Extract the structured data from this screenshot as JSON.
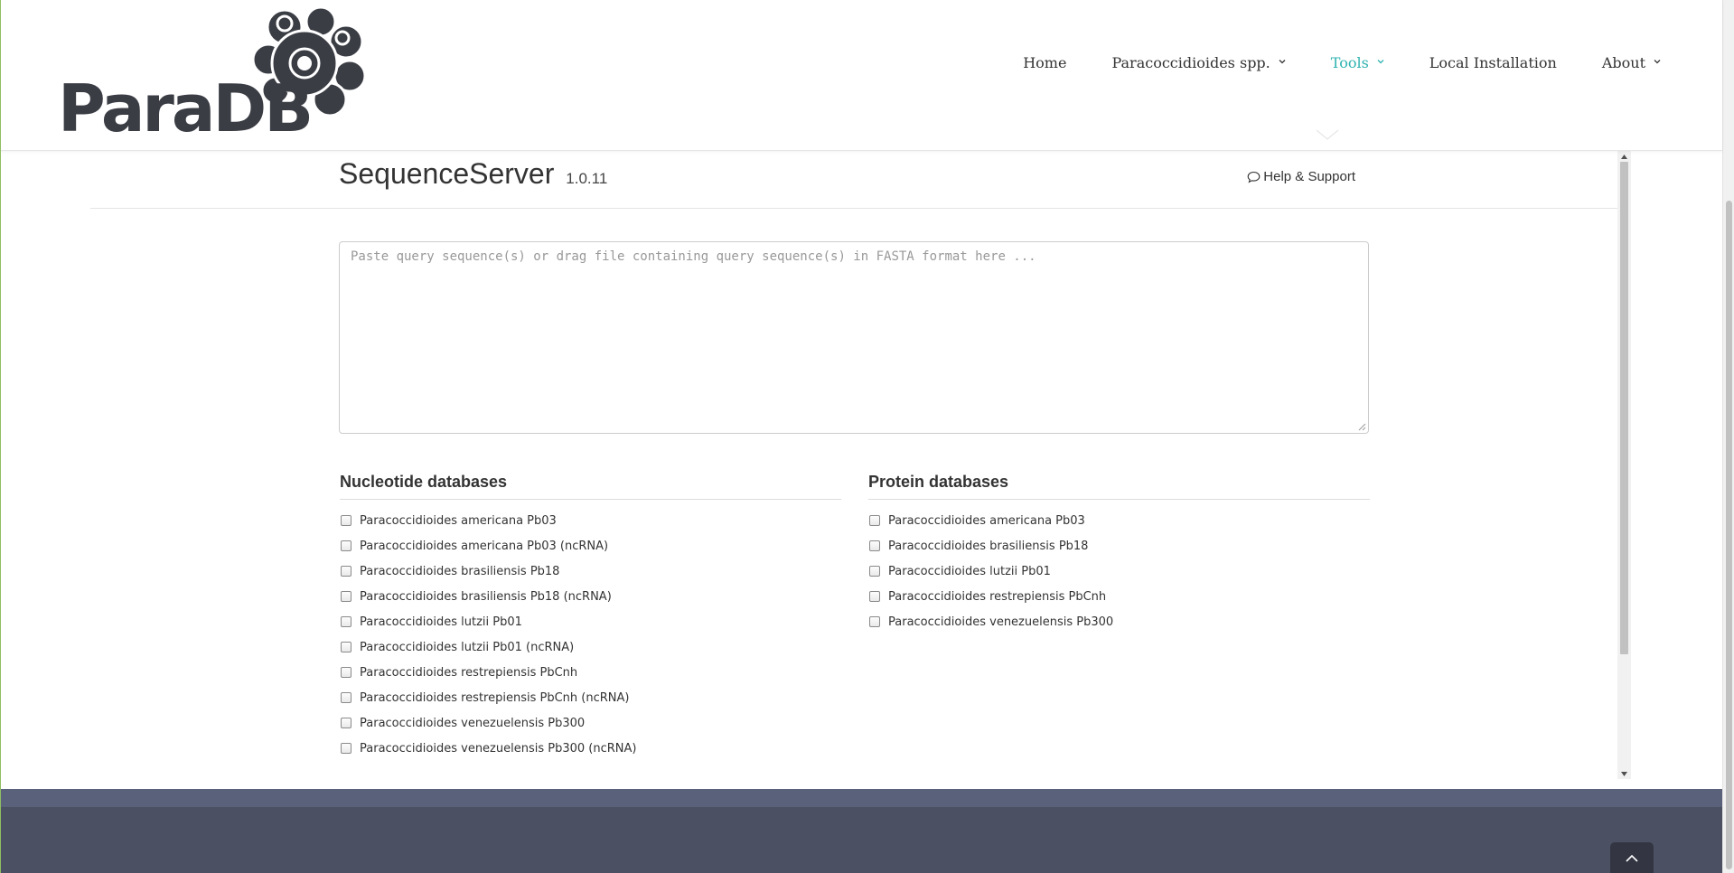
{
  "site": {
    "logo_text": "ParaDB"
  },
  "nav": {
    "items": [
      {
        "label": "Home",
        "has_dropdown": false,
        "active": false
      },
      {
        "label": "Paracoccidioides spp.",
        "has_dropdown": true,
        "active": false
      },
      {
        "label": "Tools",
        "has_dropdown": true,
        "active": true
      },
      {
        "label": "Local Installation",
        "has_dropdown": false,
        "active": false
      },
      {
        "label": "About",
        "has_dropdown": true,
        "active": false
      }
    ],
    "active_color": "#2fb3b0"
  },
  "app": {
    "title": "SequenceServer",
    "version": "1.0.11",
    "help_label": "Help & Support",
    "query_placeholder": "Paste query sequence(s) or drag file containing query sequence(s) in FASTA format here ...",
    "query_value": ""
  },
  "databases": {
    "nucleotide": {
      "heading": "Nucleotide databases",
      "items": [
        "Paracoccidioides americana Pb03",
        "Paracoccidioides americana Pb03 (ncRNA)",
        "Paracoccidioides brasiliensis Pb18",
        "Paracoccidioides brasiliensis Pb18 (ncRNA)",
        "Paracoccidioides lutzii Pb01",
        "Paracoccidioides lutzii Pb01 (ncRNA)",
        "Paracoccidioides restrepiensis PbCnh",
        "Paracoccidioides restrepiensis PbCnh (ncRNA)",
        "Paracoccidioides venezuelensis Pb300",
        "Paracoccidioides venezuelensis Pb300 (ncRNA)"
      ]
    },
    "protein": {
      "heading": "Protein databases",
      "items": [
        "Paracoccidioides americana Pb03",
        "Paracoccidioides brasiliensis Pb18",
        "Paracoccidioides lutzii Pb01",
        "Paracoccidioides restrepiensis PbCnh",
        "Paracoccidioides venezuelensis Pb300"
      ]
    }
  },
  "colors": {
    "footer_band": "#59627a",
    "footer": "#4b5063",
    "logo": "#3b3d45"
  }
}
